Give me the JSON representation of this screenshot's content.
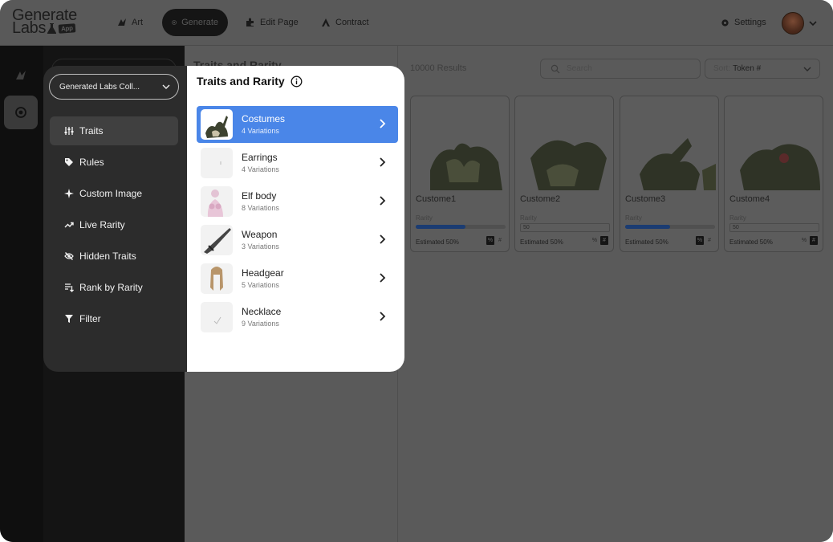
{
  "header": {
    "logo_line1": "Generate",
    "logo_line2": "Labs",
    "logo_badge": "App",
    "nav": [
      {
        "label": "Art",
        "icon": "art-icon"
      },
      {
        "label": "Generate",
        "icon": "generate-icon",
        "active": true
      },
      {
        "label": "Edit Page",
        "icon": "puzzle-icon"
      },
      {
        "label": "Contract",
        "icon": "contract-icon"
      }
    ],
    "settings_label": "Settings",
    "avatar_icon": "user-avatar"
  },
  "rail": {
    "items": [
      {
        "icon": "art-icon"
      },
      {
        "icon": "generate-icon",
        "active": true
      }
    ]
  },
  "background": {
    "title": "Traits and Rarity",
    "results": "10000 Results",
    "search_placeholder": "Search",
    "sort_label": "Sort:",
    "sort_value": "Token #",
    "cards": [
      {
        "name": "Custome1",
        "rarity_label": "Rarity",
        "rarity_mode": "slider",
        "rarity_fill": 0.55,
        "estimate": "Estimated 50%",
        "toggle_pct": "%",
        "toggle_hash": "#",
        "pct_on": true
      },
      {
        "name": "Custome2",
        "rarity_label": "Rarity",
        "rarity_mode": "input",
        "rarity_value": "50",
        "estimate": "Estimated 50%",
        "toggle_pct": "%",
        "toggle_hash": "#",
        "pct_on": false
      },
      {
        "name": "Custome3",
        "rarity_label": "Rarity",
        "rarity_mode": "slider",
        "rarity_fill": 0.5,
        "estimate": "Estimated 50%",
        "toggle_pct": "%",
        "toggle_hash": "#",
        "pct_on": true
      },
      {
        "name": "Custome4",
        "rarity_label": "Rarity",
        "rarity_mode": "input",
        "rarity_value": "50",
        "estimate": "Estimated 50%",
        "toggle_pct": "%",
        "toggle_hash": "#",
        "pct_on": false
      }
    ]
  },
  "menu": {
    "collection": "Generated Labs Coll...",
    "items": [
      {
        "label": "Traits",
        "icon": "sliders-icon",
        "active": true
      },
      {
        "label": "Rules",
        "icon": "tag-icon"
      },
      {
        "label": "Custom Image",
        "icon": "sparkle-icon"
      },
      {
        "label": "Live Rarity",
        "icon": "trend-up-icon"
      },
      {
        "label": "Hidden Traits",
        "icon": "eye-off-icon"
      },
      {
        "label": "Rank by Rarity",
        "icon": "sort-rank-icon"
      },
      {
        "label": "Filter",
        "icon": "funnel-icon"
      }
    ]
  },
  "traits_panel": {
    "title": "Traits and Rarity",
    "info_icon": "info-icon",
    "traits": [
      {
        "name": "Costumes",
        "variations": "4 Variations",
        "thumb": "armor-thumb",
        "active": true
      },
      {
        "name": "Earrings",
        "variations": "4 Variations",
        "thumb": "earring-thumb"
      },
      {
        "name": "Elf body",
        "variations": "8 Variations",
        "thumb": "elf-body-thumb"
      },
      {
        "name": "Weapon",
        "variations": "3 Variations",
        "thumb": "sword-thumb"
      },
      {
        "name": "Headgear",
        "variations": "5 Variations",
        "thumb": "hair-thumb"
      },
      {
        "name": "Necklace",
        "variations": "9 Variations",
        "thumb": "necklace-thumb"
      }
    ]
  },
  "colors": {
    "accent": "#4a86e8",
    "overlay_dark": "#2c2c2c",
    "rail": "#0f0f0f"
  }
}
